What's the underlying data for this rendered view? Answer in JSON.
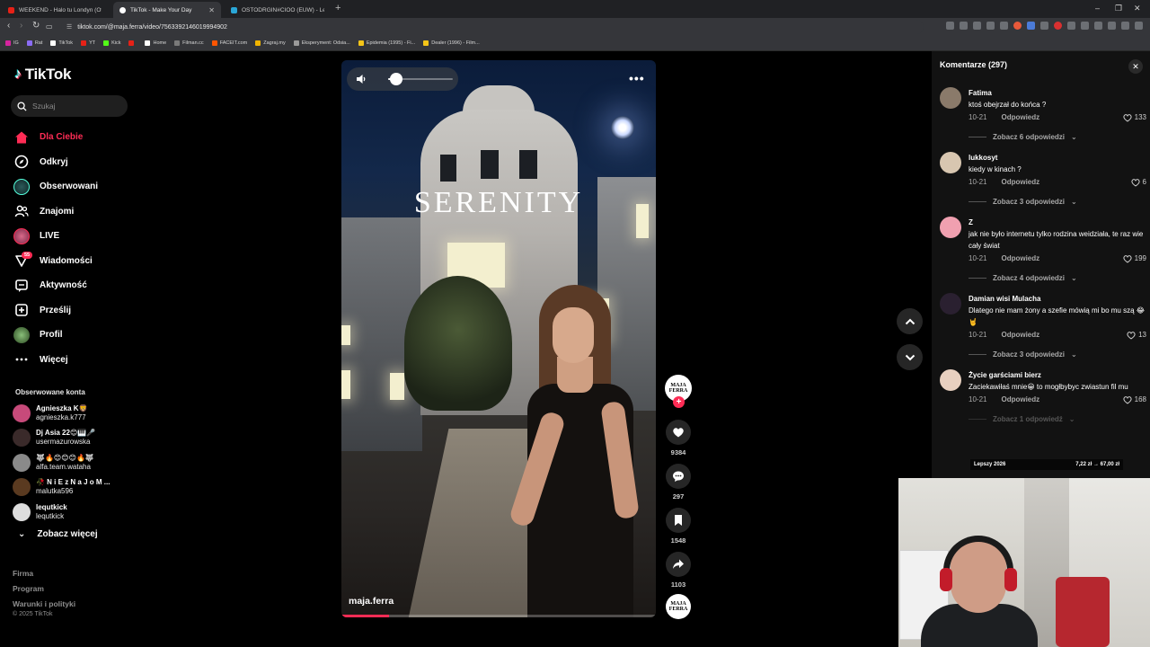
{
  "browser": {
    "tabs": [
      {
        "title": "WEEKEND - Halo tu Londyn (Oficjaln",
        "favicon_color": "#e62117",
        "active": false
      },
      {
        "title": "TikTok - Make Your Day",
        "favicon_color": "#ffffff",
        "active": true
      },
      {
        "title": "OSTODRGIN#CIOO (EUW) - League",
        "favicon_color": "#2aa6d6",
        "active": false
      }
    ],
    "new_tab_symbol": "+",
    "window_controls": [
      "–",
      "❐",
      "✕"
    ],
    "url": "tiktok.com/@maja.ferra/video/7563392146019994902",
    "bookmarks": [
      {
        "label": "IG",
        "color": "#d6249f"
      },
      {
        "label": "Rat",
        "color": "#8b6cf6"
      },
      {
        "label": "TikTok",
        "color": "#ffffff"
      },
      {
        "label": "YT",
        "color": "#e62117"
      },
      {
        "label": "Kick",
        "color": "#53fc18"
      },
      {
        "label": "",
        "color": "#e62117"
      },
      {
        "label": "Home",
        "color": "#ffffff"
      },
      {
        "label": "Filman.cc",
        "color": "#7a7a7a"
      },
      {
        "label": "FACEIT.com",
        "color": "#ff5500"
      },
      {
        "label": "Zagraj.my",
        "color": "#f0b400"
      },
      {
        "label": "Eksperyment: Odsia...",
        "color": "#9a9a9a"
      },
      {
        "label": "Epidemia (1995) - Fi...",
        "color": "#f5c518"
      },
      {
        "label": "Dealer (1996) - Film...",
        "color": "#f5c518"
      }
    ]
  },
  "tiktok": {
    "logo_text": "TikTok",
    "search_placeholder": "Szukaj",
    "nav": [
      {
        "label": "Dla Ciebie",
        "icon": "home-icon",
        "active": true
      },
      {
        "label": "Odkryj",
        "icon": "compass-icon",
        "active": false
      },
      {
        "label": "Obserwowani",
        "icon": "following-avatar-icon",
        "active": false
      },
      {
        "label": "Znajomi",
        "icon": "friends-icon",
        "active": false
      },
      {
        "label": "LIVE",
        "icon": "live-avatar-icon",
        "active": false
      },
      {
        "label": "Wiadomości",
        "icon": "inbox-icon",
        "active": false,
        "badge": "55"
      },
      {
        "label": "Aktywność",
        "icon": "activity-icon",
        "active": false
      },
      {
        "label": "Prześlij",
        "icon": "upload-icon",
        "active": false
      },
      {
        "label": "Profil",
        "icon": "profile-avatar-icon",
        "active": false
      },
      {
        "label": "Więcej",
        "icon": "more-icon",
        "active": false
      }
    ],
    "followed_title": "Obserwowane konta",
    "followed": [
      {
        "name": "Agnieszka K🦁",
        "handle": "agnieszka.k777",
        "color": "#c74a7a"
      },
      {
        "name": "Dj Asia 22😊🎹🎤",
        "handle": "usermazurowska",
        "color": "#3a2a2a"
      },
      {
        "name": "🐺🔥😊😊😊🔥🐺",
        "handle": "alfa.team.wataha",
        "color": "#8a8a8a"
      },
      {
        "name": "🥀 N i E z N a J o M ...",
        "handle": "malutka596",
        "color": "#5a3a20"
      },
      {
        "name": "lequtkick",
        "handle": "lequtkick",
        "color": "#dddddd"
      }
    ],
    "see_more": "Zobacz więcej",
    "footer_links": [
      "Firma",
      "Program",
      "Warunki i polityki"
    ],
    "copyright": "© 2025 TikTok",
    "video": {
      "overlay_text": "SERENITY",
      "author": "maja.ferra",
      "volume_fraction": 0.12,
      "progress_fraction": 0.15,
      "more_label": "•••"
    },
    "actions": {
      "avatar_text_line1": "MAJA",
      "avatar_text_line2": "FERRA",
      "likes": "9384",
      "comments": "297",
      "saves": "1548",
      "shares": "1103"
    },
    "comments": {
      "title": "Komentarze (297)",
      "close_symbol": "✕",
      "reply_label": "Odpowiedz",
      "items": [
        {
          "user": "Fatima",
          "text": "ktoś obejrzał do końca ?",
          "date": "10-21",
          "likes": "133",
          "replies": "Zobacz 6 odpowiedzi",
          "avatar_color": "#8a7a6a"
        },
        {
          "user": "lukkosyt",
          "text": "kiedy w kinach ?",
          "date": "10-21",
          "likes": "6",
          "replies": "Zobacz 3 odpowiedzi",
          "avatar_color": "#d8c6b0"
        },
        {
          "user": "Z",
          "text": "jak nie było internetu tylko rodzina weidziała, te raz wie cały świat",
          "date": "10-21",
          "likes": "199",
          "replies": "Zobacz 4 odpowiedzi",
          "avatar_color": "#f0a0b0"
        },
        {
          "user": "Damian wisi Mulacha",
          "text": "Dlatego nie mam żony a szefie mówią mi bo mu szą 😂🤘",
          "date": "10-21",
          "likes": "13",
          "replies": "Zobacz 3 odpowiedzi",
          "avatar_color": "#2a2030"
        },
        {
          "user": "Życie garściami bierz",
          "text": "Zaciekawiłaś mnie😀 to mogłbybyc zwiastun fil mu",
          "date": "10-21",
          "likes": "168",
          "replies": "Zobacz 1 odpowiedź",
          "avatar_color": "#e8d0c0"
        }
      ]
    }
  },
  "stream_overlay": {
    "left_label": "Lepszy 2026",
    "right_label": "7,22 zł → 67,00 zł"
  },
  "colors": {
    "accent": "#fe2c55",
    "background": "#000000",
    "panel": "#121212"
  }
}
